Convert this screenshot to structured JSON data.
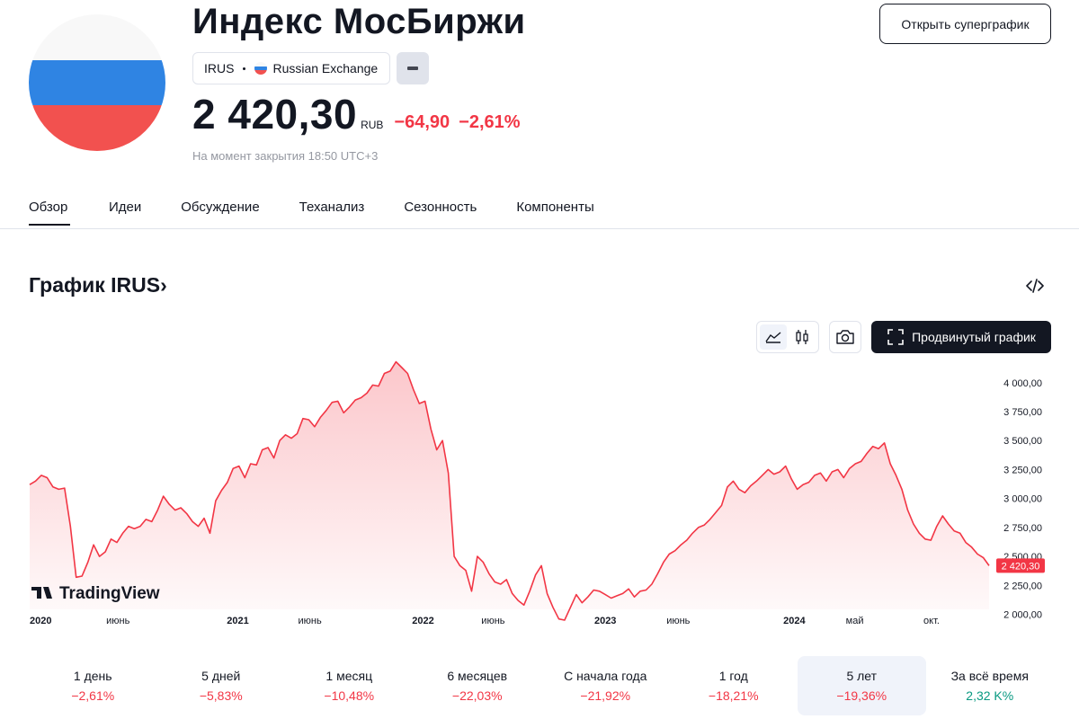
{
  "header": {
    "title": "Индекс МосБиржи",
    "ticker": "IRUS",
    "exchange": "Russian Exchange",
    "price": "2 420,30",
    "currency": "RUB",
    "change": "−64,90",
    "change_pct": "−2,61%",
    "close_note": "На момент закрытия 18:50 UTC+3",
    "supergraph_label": "Открыть суперграфик",
    "flag_colors": [
      "#f8f8f8",
      "#2f84e3",
      "#f2514f"
    ]
  },
  "tabs": [
    {
      "label": "Обзор",
      "active": true
    },
    {
      "label": "Идеи"
    },
    {
      "label": "Обсуждение"
    },
    {
      "label": "Теханализ"
    },
    {
      "label": "Сезонность"
    },
    {
      "label": "Компоненты"
    }
  ],
  "chart_section": {
    "title": "График IRUS",
    "title_arrow": "›",
    "advanced_label": "Продвинутый график",
    "watermark": "TradingView",
    "current_price_label": "2 420,30"
  },
  "chart_data": {
    "type": "area",
    "color": "#f23645",
    "ylim": [
      1950,
      4200
    ],
    "y_ticks": [
      2000,
      2250,
      2500,
      2750,
      3000,
      3250,
      3500,
      3750,
      4000
    ],
    "y_tick_labels": [
      "2 000,00",
      "2 250,00",
      "2 500,00",
      "2 750,00",
      "3 000,00",
      "3 250,00",
      "3 500,00",
      "3 750,00",
      "4 000,00"
    ],
    "x_ticks": [
      {
        "label": "2020",
        "t": 0.0,
        "bold": true
      },
      {
        "label": "июнь",
        "t": 0.092,
        "bold": false
      },
      {
        "label": "2021",
        "t": 0.217,
        "bold": true
      },
      {
        "label": "июнь",
        "t": 0.292,
        "bold": false
      },
      {
        "label": "2022",
        "t": 0.41,
        "bold": true
      },
      {
        "label": "июнь",
        "t": 0.483,
        "bold": false
      },
      {
        "label": "2023",
        "t": 0.6,
        "bold": true
      },
      {
        "label": "июнь",
        "t": 0.676,
        "bold": false
      },
      {
        "label": "2024",
        "t": 0.797,
        "bold": true
      },
      {
        "label": "май",
        "t": 0.86,
        "bold": false
      },
      {
        "label": "окт.",
        "t": 0.94,
        "bold": false
      }
    ],
    "series": [
      {
        "values": [
          3120,
          3150,
          3200,
          3180,
          3100,
          3080,
          3090,
          2760,
          2320,
          2330,
          2450,
          2600,
          2500,
          2540,
          2650,
          2620,
          2700,
          2760,
          2740,
          2760,
          2820,
          2800,
          2900,
          3020,
          2950,
          2900,
          2920,
          2870,
          2800,
          2760,
          2830,
          2700,
          2980,
          3070,
          3140,
          3260,
          3280,
          3180,
          3300,
          3290,
          3420,
          3440,
          3350,
          3500,
          3550,
          3520,
          3560,
          3690,
          3680,
          3620,
          3700,
          3760,
          3830,
          3840,
          3740,
          3790,
          3850,
          3870,
          3910,
          3980,
          3970,
          4080,
          4100,
          4180,
          4130,
          4080,
          3940,
          3820,
          3840,
          3600,
          3420,
          3500,
          3220,
          2500,
          2420,
          2380,
          2200,
          2500,
          2450,
          2350,
          2280,
          2260,
          2300,
          2180,
          2120,
          2080,
          2200,
          2340,
          2420,
          2180,
          2060,
          1960,
          1950,
          2060,
          2170,
          2100,
          2150,
          2210,
          2200,
          2170,
          2140,
          2160,
          2180,
          2220,
          2150,
          2200,
          2210,
          2260,
          2350,
          2450,
          2520,
          2550,
          2600,
          2640,
          2700,
          2750,
          2770,
          2820,
          2880,
          2940,
          3100,
          3150,
          3080,
          3050,
          3110,
          3150,
          3200,
          3250,
          3210,
          3230,
          3280,
          3170,
          3080,
          3120,
          3140,
          3200,
          3220,
          3150,
          3230,
          3250,
          3180,
          3260,
          3300,
          3320,
          3390,
          3450,
          3430,
          3480,
          3300,
          3200,
          3080,
          2900,
          2780,
          2700,
          2650,
          2640,
          2760,
          2850,
          2780,
          2720,
          2700,
          2620,
          2580,
          2520,
          2490,
          2420
        ]
      }
    ]
  },
  "periods": [
    {
      "label": "1 день",
      "value": "−2,61%",
      "sign": "neg"
    },
    {
      "label": "5 дней",
      "value": "−5,83%",
      "sign": "neg"
    },
    {
      "label": "1 месяц",
      "value": "−10,48%",
      "sign": "neg"
    },
    {
      "label": "6 месяцев",
      "value": "−22,03%",
      "sign": "neg"
    },
    {
      "label": "С начала года",
      "value": "−21,92%",
      "sign": "neg"
    },
    {
      "label": "1 год",
      "value": "−18,21%",
      "sign": "neg"
    },
    {
      "label": "5 лет",
      "value": "−19,36%",
      "sign": "neg",
      "selected": true
    },
    {
      "label": "За всё время",
      "value": "2,32 K%",
      "sign": "pos"
    }
  ]
}
